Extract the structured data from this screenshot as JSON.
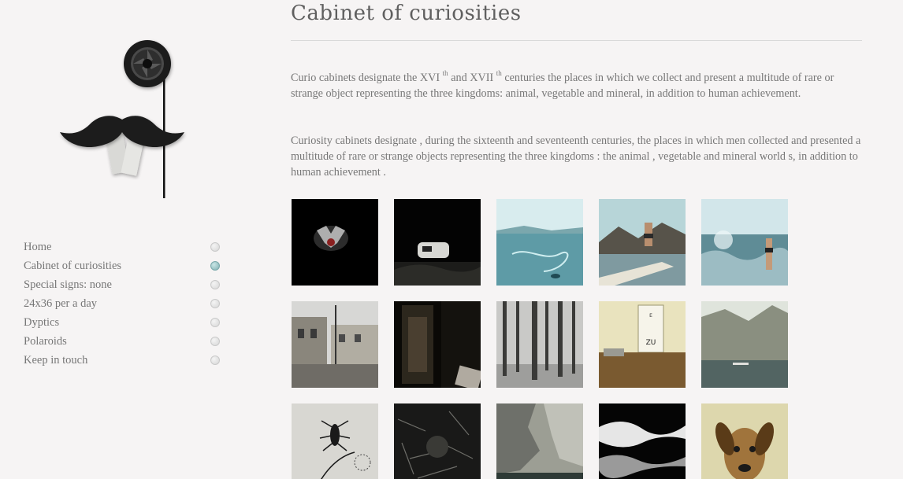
{
  "page": {
    "title": "Cabinet of curiosities",
    "paragraph1": {
      "part1": "Curio cabinets designate the XVI",
      "sup1": "th",
      "part2": " and XVII",
      "sup2": "th",
      "part3": " centuries the places in which we collect and present a multitude of rare or strange object representing the three kingdoms: animal, vegetable and mineral, in addition to human achievement."
    },
    "paragraph2": " Curiosity cabinets designate , during the sixteenth and seventeenth centuries, the places in which men collected and presented a multitude of rare or strange objects representing the three kingdoms : the animal , vegetable and mineral world s, in addition to human achievement ."
  },
  "nav": {
    "items": [
      {
        "label": "Home",
        "active": false
      },
      {
        "label": "Cabinet of curiosities",
        "active": true
      },
      {
        "label": "Special signs: none",
        "active": false
      },
      {
        "label": "24x36 per a day",
        "active": false
      },
      {
        "label": "Dyptics",
        "active": false
      },
      {
        "label": "Polaroids",
        "active": false
      },
      {
        "label": "Keep in touch",
        "active": false
      }
    ]
  },
  "logo": {
    "icon": "mustache-monocle-logo-icon"
  },
  "gallery": {
    "thumbnails": [
      {
        "name": "thumb-dark-dog",
        "colors": [
          "#000000",
          "#1a1a1a"
        ]
      },
      {
        "name": "thumb-caravan-night",
        "colors": [
          "#020202",
          "#2a2a2a"
        ]
      },
      {
        "name": "thumb-blue-lake",
        "colors": [
          "#8fc4cc",
          "#4e8c9a"
        ]
      },
      {
        "name": "thumb-swimmer-pier",
        "colors": [
          "#a9c7cc",
          "#4a4a3a"
        ]
      },
      {
        "name": "thumb-sea-swimmer",
        "colors": [
          "#b8d6df",
          "#5e8a94"
        ]
      },
      {
        "name": "thumb-village-street",
        "colors": [
          "#cfcfcf",
          "#6e6a62"
        ]
      },
      {
        "name": "thumb-dark-wardrobe",
        "colors": [
          "#2a2620",
          "#050505"
        ]
      },
      {
        "name": "thumb-bare-forest",
        "colors": [
          "#c8c8c8",
          "#3c3c3c"
        ]
      },
      {
        "name": "thumb-eye-chart-desk",
        "colors": [
          "#e8e1b8",
          "#6a4a22"
        ]
      },
      {
        "name": "thumb-mountain-lake",
        "colors": [
          "#d6dcd2",
          "#5f6c66"
        ]
      },
      {
        "name": "thumb-insect-plant",
        "colors": [
          "#d8d8d4",
          "#8a8a86"
        ]
      },
      {
        "name": "thumb-dark-texture",
        "colors": [
          "#4a4a46",
          "#0c0c0c"
        ]
      },
      {
        "name": "thumb-rock-cliff",
        "colors": [
          "#a8aaa0",
          "#2e342e"
        ]
      },
      {
        "name": "thumb-black-wave",
        "colors": [
          "#f4f4f4",
          "#050505"
        ]
      },
      {
        "name": "thumb-dog-portrait",
        "colors": [
          "#ddd8b0",
          "#7a5a30"
        ]
      }
    ]
  }
}
